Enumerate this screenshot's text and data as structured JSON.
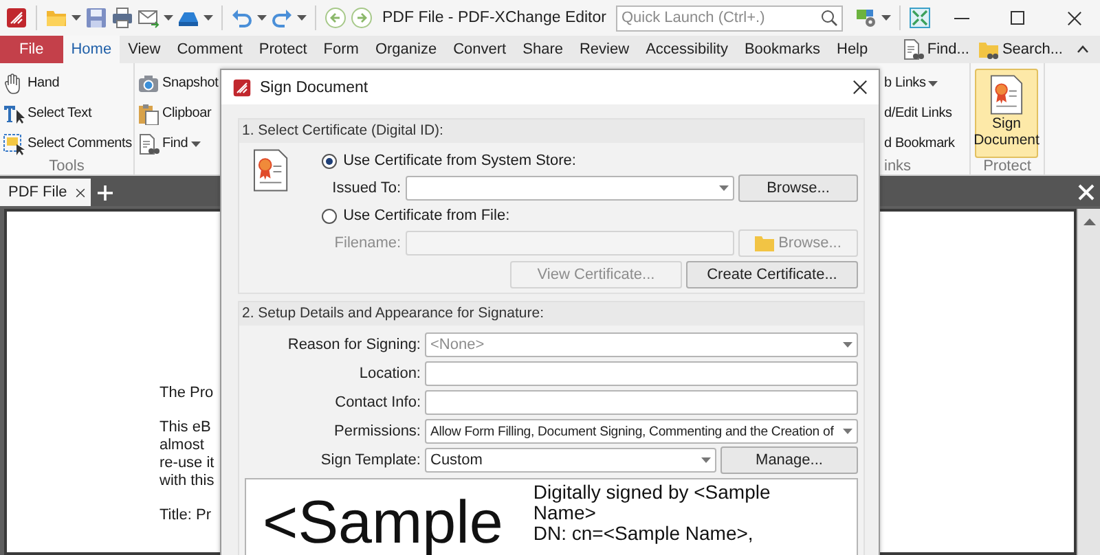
{
  "title_bar": {
    "title": "PDF File - PDF-XChange Editor",
    "quick_launch": {
      "placeholder": "Quick Launch (Ctrl+.)"
    }
  },
  "menu_tabs": [
    {
      "label": "File",
      "kind": "file",
      "selected": false
    },
    {
      "label": "Home",
      "kind": "tab",
      "selected": true
    },
    {
      "label": "View",
      "kind": "tab",
      "selected": false
    },
    {
      "label": "Comment",
      "kind": "tab",
      "selected": false
    },
    {
      "label": "Protect",
      "kind": "tab",
      "selected": false
    },
    {
      "label": "Form",
      "kind": "tab",
      "selected": false
    },
    {
      "label": "Organize",
      "kind": "tab",
      "selected": false
    },
    {
      "label": "Convert",
      "kind": "tab",
      "selected": false
    },
    {
      "label": "Share",
      "kind": "tab",
      "selected": false
    },
    {
      "label": "Review",
      "kind": "tab",
      "selected": false
    },
    {
      "label": "Accessibility",
      "kind": "tab",
      "selected": false
    },
    {
      "label": "Bookmarks",
      "kind": "tab",
      "selected": false
    },
    {
      "label": "Help",
      "kind": "tab",
      "selected": false
    }
  ],
  "menu_tools": [
    {
      "label": "Find...",
      "kind": "find"
    },
    {
      "label": "Search...",
      "kind": "search"
    }
  ],
  "ribbon": {
    "tools": {
      "label": "Tools",
      "items": [
        {
          "label": "Hand",
          "kind": "hand",
          "dropdown": false
        },
        {
          "label": "Select Text",
          "kind": "text",
          "dropdown": false
        },
        {
          "label": "Select Comments",
          "kind": "comments",
          "dropdown": false
        }
      ]
    },
    "clipboard": {
      "items": [
        {
          "label": "Snapshot",
          "kind": "camera",
          "dropdown": false
        },
        {
          "label": "Clipboar",
          "kind": "clipboard",
          "dropdown": false
        },
        {
          "label": "Find",
          "kind": "find",
          "dropdown": true
        }
      ]
    },
    "links": {
      "label": "inks",
      "items": [
        {
          "label": "b Links",
          "dropdown": true
        },
        {
          "label": "d/Edit Links",
          "dropdown": false
        },
        {
          "label": "d Bookmark",
          "dropdown": false
        }
      ]
    },
    "protect": {
      "label": "Protect",
      "button": {
        "label": "Sign Document",
        "selected": true
      }
    }
  },
  "doc_tabs": [
    {
      "label": "PDF File",
      "selected": true
    }
  ],
  "page_paragraphs": [
    [
      "The Pro"
    ],
    [
      "This eB",
      "almost",
      "re-use it",
      "with this"
    ],
    [
      "Title: Pr"
    ]
  ],
  "dialog": {
    "title": "Sign Document",
    "section1": {
      "heading": "1. Select Certificate (Digital ID):",
      "options": [
        {
          "label": "Use Certificate from System Store:",
          "selected": true,
          "field_label": "Issued To:",
          "kind": "dropdown",
          "button": "Browse..."
        },
        {
          "label": "Use Certificate from File:",
          "selected": false,
          "field_label": "Filename:",
          "kind": "file",
          "button": "Browse..."
        }
      ],
      "buttons": [
        {
          "label": "View Certificate...",
          "disabled": true
        },
        {
          "label": "Create Certificate...",
          "disabled": false
        }
      ]
    },
    "section2": {
      "heading": "2. Setup Details and Appearance for Signature:",
      "fields": [
        {
          "label": "Reason for Signing:",
          "kind": "dropdown",
          "placeholder": "<None>"
        },
        {
          "label": "Location:",
          "kind": "text"
        },
        {
          "label": "Contact Info:",
          "kind": "text"
        },
        {
          "label": "Permissions:",
          "kind": "dropdown",
          "value": "Allow Form Filling, Document Signing, Commenting and the Creation of"
        },
        {
          "label": "Sign Template:",
          "kind": "dropdown",
          "value": "Custom",
          "button": "Manage..."
        }
      ]
    },
    "preview": {
      "name": "<Sample",
      "details": [
        "Digitally signed by <Sample",
        "Name>",
        "DN: cn=<Sample Name>,"
      ]
    }
  }
}
